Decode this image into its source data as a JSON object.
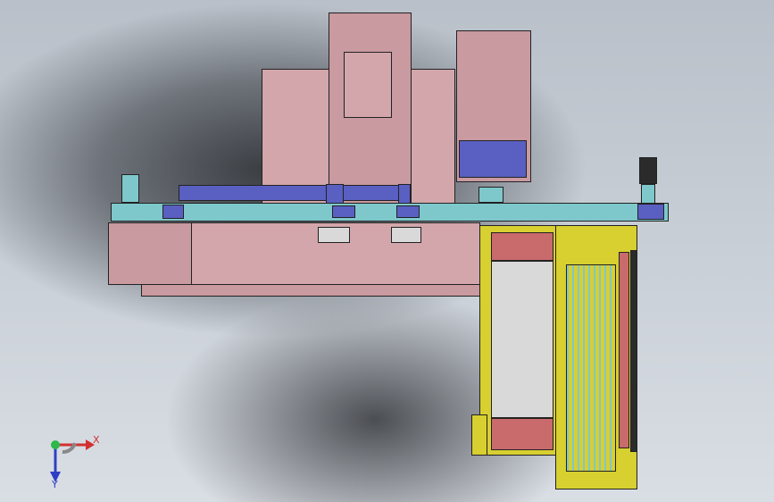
{
  "view": {
    "triad": {
      "x_label": "X",
      "y_label": "Y",
      "colors": {
        "x": "#d23030",
        "y": "#2cb84a",
        "z": "#2f3fc4"
      }
    }
  },
  "model": {
    "colors": {
      "frame": "#c99aa0",
      "slide": "#5a5fc2",
      "rail": "#7ec8cc",
      "feeder": "#d8cf30",
      "belt": "#c96a6c"
    }
  }
}
